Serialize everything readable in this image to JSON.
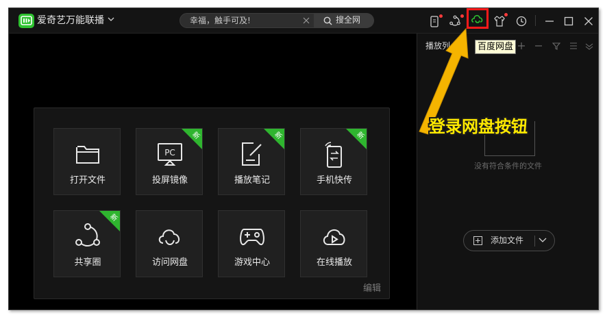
{
  "app": {
    "title": "爱奇艺万能联播"
  },
  "search": {
    "placeholder": "幸福，触手可及!",
    "button_label": "搜全网"
  },
  "toolbar": {
    "icons": [
      "phone-icon",
      "share-icon",
      "baidu-pan-icon",
      "skin-icon",
      "history-icon"
    ],
    "tooltip": "百度网盘"
  },
  "window_controls": [
    "minimize-icon",
    "maximize-icon",
    "close-icon"
  ],
  "tiles": [
    {
      "label": "打开文件",
      "icon": "folder-icon",
      "new": false
    },
    {
      "label": "投屏镜像",
      "icon": "pc-cast-icon",
      "new": true
    },
    {
      "label": "播放笔记",
      "icon": "note-icon",
      "new": true
    },
    {
      "label": "手机快传",
      "icon": "phone-transfer-icon",
      "new": true
    },
    {
      "label": "共享圈",
      "icon": "share-circle-icon",
      "new": true
    },
    {
      "label": "访问网盘",
      "icon": "cloud-pan-icon",
      "new": false
    },
    {
      "label": "游戏中心",
      "icon": "gamepad-icon",
      "new": false
    },
    {
      "label": "在线播放",
      "icon": "cloud-play-icon",
      "new": false
    }
  ],
  "new_badge": "新",
  "edit_label": "编辑",
  "playlist": {
    "title": "播放列",
    "empty_text": "没有符合条件的文件",
    "add_label": "添加文件"
  },
  "annotation": {
    "text": "登录网盘按钮",
    "color": "#ffea00"
  },
  "colors": {
    "accent": "#2fc231",
    "highlight": "#ff1a1a",
    "arrow": "#f5b400"
  }
}
